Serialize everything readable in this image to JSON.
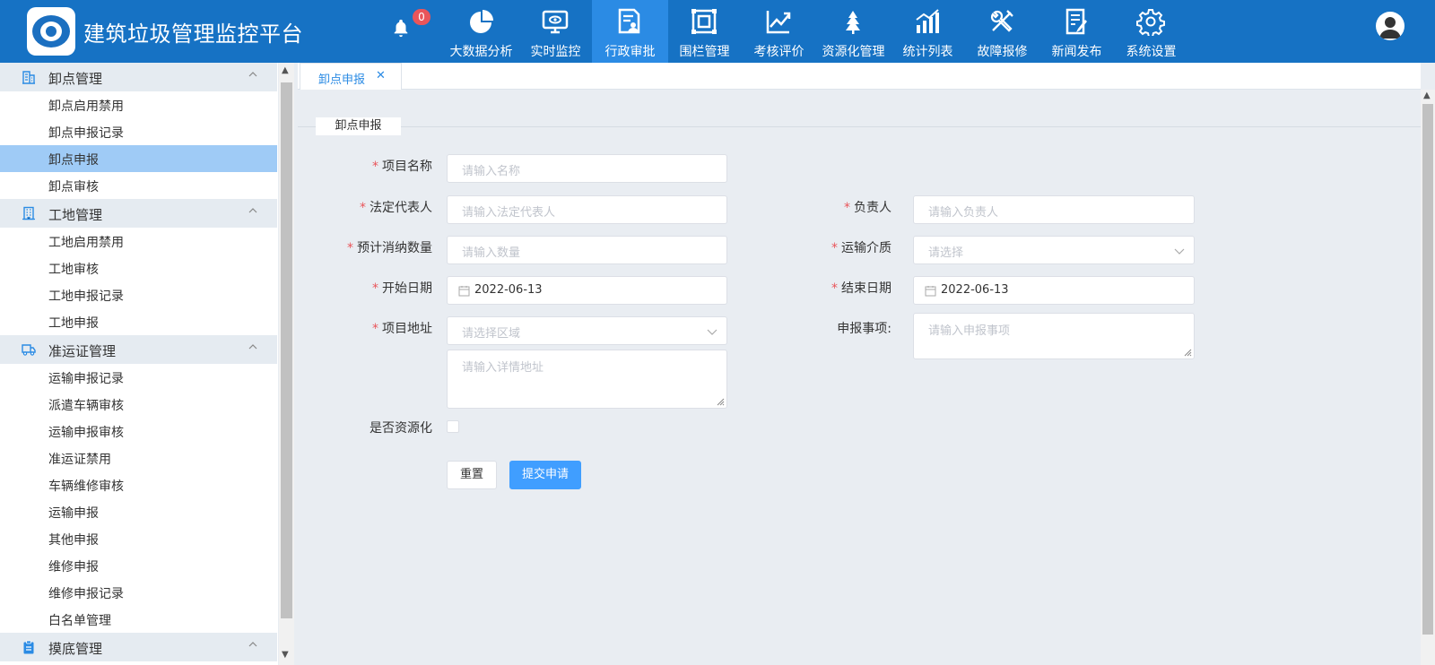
{
  "header": {
    "title": "建筑垃圾管理监控平台",
    "notification_count": "0",
    "nav": [
      {
        "label": "大数据分析",
        "icon": "pie-chart-icon"
      },
      {
        "label": "实时监控",
        "icon": "monitor-icon"
      },
      {
        "label": "行政审批",
        "icon": "approval-doc-icon",
        "active": true
      },
      {
        "label": "围栏管理",
        "icon": "fence-frame-icon"
      },
      {
        "label": "考核评价",
        "icon": "trend-chart-icon"
      },
      {
        "label": "资源化管理",
        "icon": "tree-icon"
      },
      {
        "label": "统计列表",
        "icon": "bar-chart-icon"
      },
      {
        "label": "故障报修",
        "icon": "tools-icon"
      },
      {
        "label": "新闻发布",
        "icon": "news-edit-icon"
      },
      {
        "label": "系统设置",
        "icon": "gear-icon"
      }
    ]
  },
  "sidebar": {
    "groups": [
      {
        "label": "卸点管理",
        "icon": "building-icon",
        "items": [
          "卸点启用禁用",
          "卸点申报记录",
          "卸点申报",
          "卸点审核"
        ]
      },
      {
        "label": "工地管理",
        "icon": "office-icon",
        "items": [
          "工地启用禁用",
          "工地审核",
          "工地申报记录",
          "工地申报"
        ]
      },
      {
        "label": "准运证管理",
        "icon": "truck-icon",
        "items": [
          "运输申报记录",
          "派遣车辆审核",
          "运输申报审核",
          "准运证禁用",
          "车辆维修审核",
          "运输申报",
          "其他申报",
          "维修申报",
          "维修申报记录",
          "白名单管理"
        ]
      },
      {
        "label": "摸底管理",
        "icon": "clipboard-icon",
        "items": []
      }
    ],
    "active_item": "卸点申报"
  },
  "tabs": [
    {
      "label": "卸点申报",
      "close": "✕"
    }
  ],
  "form": {
    "section_title": "卸点申报",
    "required_mark": "*",
    "project_name": {
      "label": "项目名称",
      "placeholder": "请输入名称"
    },
    "legal_rep": {
      "label": "法定代表人",
      "placeholder": "请输入法定代表人"
    },
    "person_in_charge": {
      "label": "负责人",
      "placeholder": "请输入负责人"
    },
    "expected_quantity": {
      "label": "预计消纳数量",
      "placeholder": "请输入数量"
    },
    "transport_medium": {
      "label": "运输介质",
      "placeholder": "请选择"
    },
    "start_date": {
      "label": "开始日期",
      "value": "2022-06-13"
    },
    "end_date": {
      "label": "结束日期",
      "value": "2022-06-13"
    },
    "project_address": {
      "label": "项目地址",
      "region_placeholder": "请选择区域",
      "detail_placeholder": "请输入详情地址"
    },
    "declaration_items": {
      "label": "申报事项:",
      "placeholder": "请输入申报事项"
    },
    "is_resource": {
      "label": "是否资源化"
    },
    "reset_button": "重置",
    "submit_button": "提交申请"
  },
  "colors": {
    "header_bg": "#1672c4",
    "nav_active": "#2b8be4",
    "primary": "#409eff",
    "required": "#e9555a",
    "sidebar_active": "#9fcbf6"
  }
}
